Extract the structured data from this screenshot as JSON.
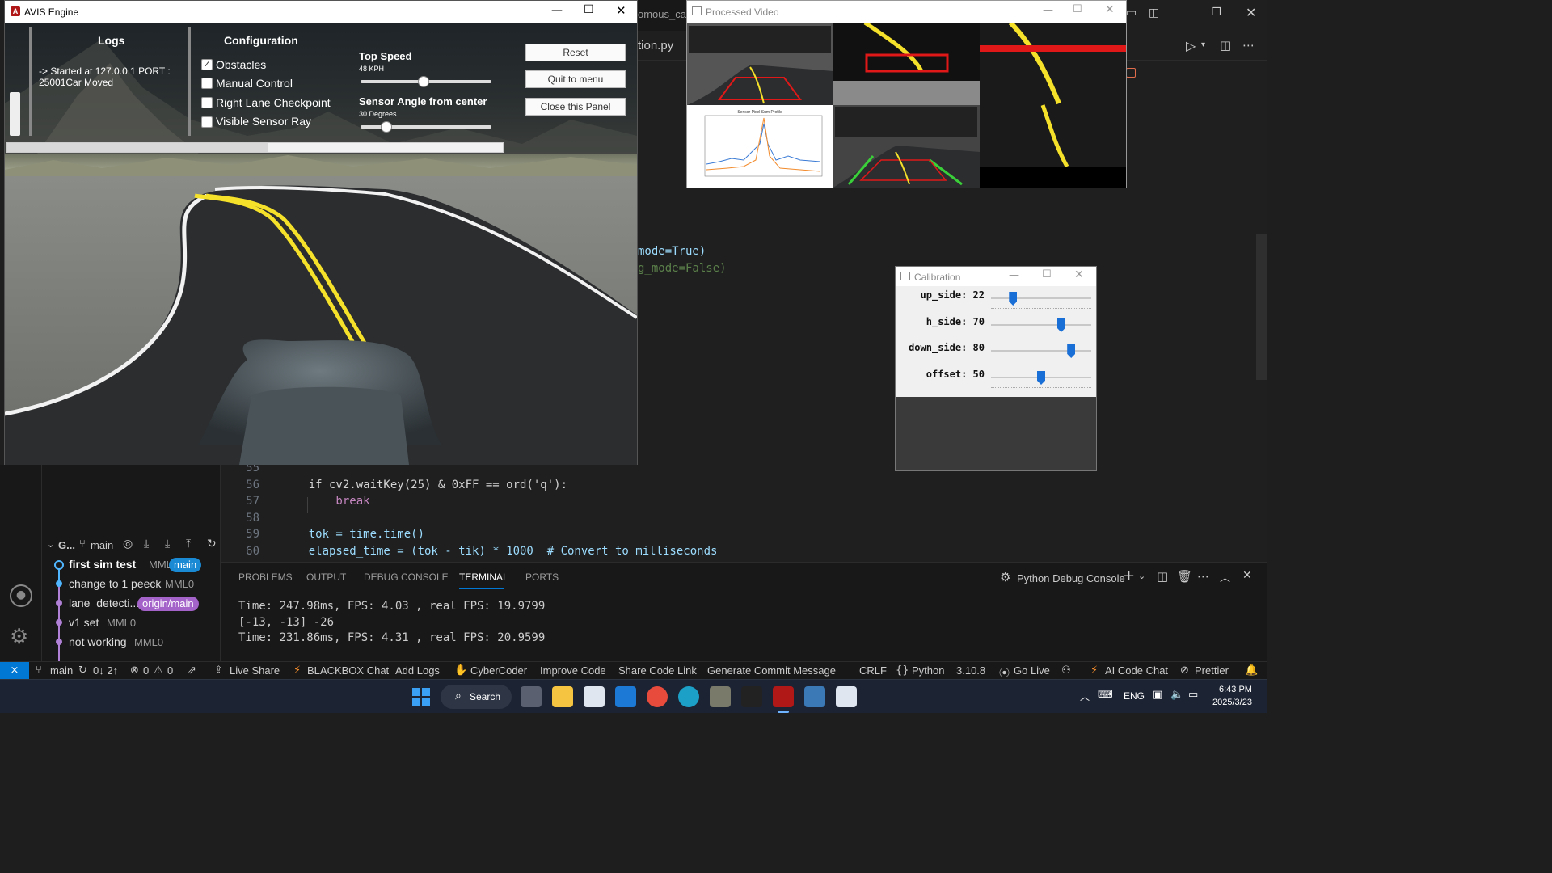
{
  "avis": {
    "title": "AVIS Engine",
    "logs_heading": "Logs",
    "log_text": "-> Started at 127.0.0.1 PORT : 25001Car Moved",
    "config_heading": "Configuration",
    "checkboxes": [
      {
        "label": "Obstacles",
        "checked": true
      },
      {
        "label": "Manual Control",
        "checked": false
      },
      {
        "label": "Right Lane Checkpoint",
        "checked": false
      },
      {
        "label": "Visible Sensor Ray",
        "checked": false
      }
    ],
    "top_speed_label": "Top Speed",
    "top_speed_value": "48 KPH",
    "top_speed_fraction": 0.48,
    "sensor_angle_label": "Sensor Angle from center",
    "sensor_angle_value": "30 Degrees",
    "sensor_angle_fraction": 0.2,
    "reset_button": "Reset",
    "quit_button": "Quit to menu",
    "close_button": "Close this Panel"
  },
  "processed_video": {
    "title": "Processed Video",
    "chart_title": "Sensor Pixel Sum Profile"
  },
  "calibration": {
    "title": "Calibration",
    "sliders": [
      {
        "label": "up_side: 22",
        "fraction": 0.22
      },
      {
        "label": "h_side: 70",
        "fraction": 0.7
      },
      {
        "label": "down_side: 80",
        "fraction": 0.8
      },
      {
        "label": "offset: 50",
        "fraction": 0.5
      }
    ]
  },
  "editor": {
    "tab_fragment_1": "omous_car",
    "tab_fragment_2": "tion.py",
    "code_top": [
      {
        "text": "mode=True)"
      },
      {
        "text": "g_mode=False)"
      }
    ],
    "lines": [
      {
        "num": "55",
        "text": ""
      },
      {
        "num": "56",
        "text": "    if cv2.waitKey(25) & 0xFF == ord('q'):"
      },
      {
        "num": "57",
        "text": "        break"
      },
      {
        "num": "58",
        "text": ""
      },
      {
        "num": "59",
        "text": "    tok = time.time()"
      },
      {
        "num": "60",
        "text": "    elapsed_time = (tok - tik) * 1000  # Convert to milliseconds"
      }
    ]
  },
  "panel": {
    "tabs": [
      "PROBLEMS",
      "OUTPUT",
      "DEBUG CONSOLE",
      "TERMINAL",
      "PORTS"
    ],
    "active_tab": "TERMINAL",
    "terminal_name": "Python Debug Console",
    "terminal_lines": [
      "Time: 247.98ms, FPS: 4.03 , real FPS: 19.9799",
      "[-13, -13] -26",
      "Time: 231.86ms, FPS: 4.31 , real FPS: 20.9599"
    ]
  },
  "sidebar": {
    "graph_header": "G...",
    "branch": "main",
    "commits": [
      {
        "message": "first sim test",
        "author": "MML0",
        "badge": "main",
        "color": "#4fb6ff"
      },
      {
        "message": "change to 1 peeck",
        "author": "MML0",
        "badge": "",
        "color": "#4fb6ff"
      },
      {
        "message": "lane_detecti...",
        "author": "",
        "badge": "origin/main",
        "color": "#b180d7"
      },
      {
        "message": "v1 set",
        "author": "MML0",
        "badge": "",
        "color": "#b180d7"
      },
      {
        "message": "not working",
        "author": "MML0",
        "badge": "",
        "color": "#b180d7"
      }
    ]
  },
  "statusbar": {
    "branch": "main",
    "sync": "0↓ 2↑",
    "errors": "0",
    "warnings": "0",
    "items": [
      "Live Share",
      "BLACKBOX Chat",
      "Add Logs",
      "CyberCoder",
      "Improve Code",
      "Share Code Link",
      "Generate Commit Message"
    ],
    "right_items": [
      "CRLF",
      "Python",
      "3.10.8",
      "Go Live",
      "AI Code Chat",
      "Prettier"
    ]
  },
  "taskbar": {
    "search": "Search",
    "lang": "ENG",
    "time": "6:43 PM",
    "date": "2025/3/23"
  },
  "colors": {
    "accent": "#0078d4",
    "keyword": "#c586c0",
    "function": "#dcdcaa",
    "variable": "#9cdcfe",
    "number": "#b5cea8",
    "string": "#ce9178",
    "comment": "#6a9955",
    "lane_yellow": "#f5e02a"
  }
}
